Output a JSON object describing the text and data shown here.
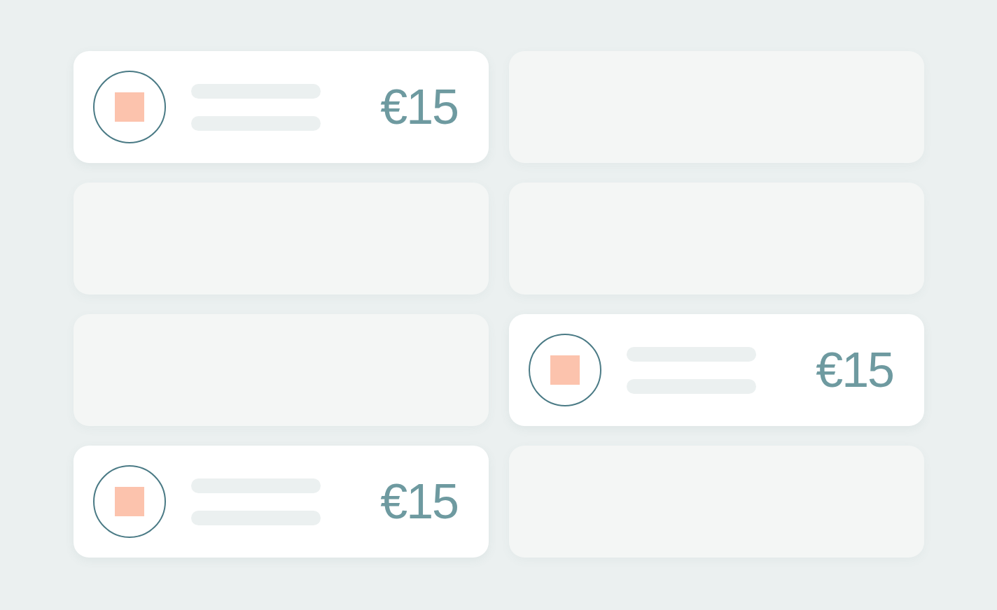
{
  "cards": [
    {
      "kind": "item",
      "price": "€15"
    },
    {
      "kind": "empty"
    },
    {
      "kind": "empty"
    },
    {
      "kind": "empty"
    },
    {
      "kind": "empty"
    },
    {
      "kind": "item",
      "price": "€15"
    },
    {
      "kind": "item",
      "price": "€15"
    },
    {
      "kind": "empty"
    }
  ]
}
